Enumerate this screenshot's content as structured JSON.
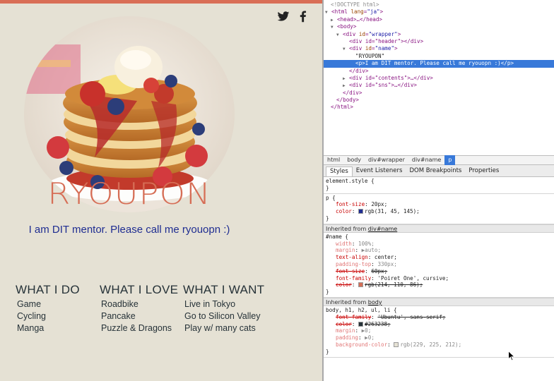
{
  "page": {
    "name_title": "RYOUPON",
    "mentor_text": "I am DIT mentor. Please call me ryouopn :)",
    "sns_icons": [
      "twitter-icon",
      "facebook-icon"
    ],
    "hero_image": "pancake-stack-photo",
    "columns": [
      {
        "heading": "WHAT I DO",
        "items": [
          "Game",
          "Cycling",
          "Manga"
        ]
      },
      {
        "heading": "WHAT I LOVE",
        "items": [
          "Roadbike",
          "Pancake",
          "Puzzle & Dragons"
        ]
      },
      {
        "heading": "WHAT I WANT",
        "items": [
          "Live in Tokyo",
          "Go to Silicon Valley",
          "Play w/ many cats"
        ]
      }
    ],
    "colors": {
      "background": "#e5e1d4",
      "accent": "#d66e56",
      "mentor_text": "#1f2d91",
      "text": "#263238"
    }
  },
  "devtools": {
    "dom": {
      "doctype": "<!DOCTYPE html>",
      "html_open_tag": "html",
      "html_lang_attr": "lang",
      "html_lang_val": "\"ja\"",
      "head": "<head>…</head>",
      "body_open": "<body>",
      "wrapper_tag": "<div ",
      "wrapper_attr": "id",
      "wrapper_val": "\"wrapper\"",
      "header_line": "<div id=\"header\"></div>",
      "name_tag": "<div ",
      "name_attr": "id",
      "name_val": "\"name\"",
      "name_text": "\"RYOUPON\"",
      "p_line": "<p>I am DIT mentor. Please call me ryouopn :)</p>",
      "div_close": "</div>",
      "contents_line": "<div id=\"contents\">…</div>",
      "sns_line": "<div id=\"sns\">…</div>",
      "div_close2": "</div>",
      "body_close": "</body>",
      "html_close": "</html>"
    },
    "breadcrumbs": [
      "html",
      "body",
      "div#wrapper",
      "div#name",
      "p"
    ],
    "tabs": [
      "Styles",
      "Event Listeners",
      "DOM Breakpoints",
      "Properties"
    ],
    "styles": {
      "element_style_open": "element.style {",
      "element_style_close": "}",
      "p_rule_selector": "p {",
      "p_font_size_name": "font-size",
      "p_font_size_val": "20px;",
      "p_color_name": "color",
      "p_color_val": "rgb(31, 45, 145);",
      "p_color_hex": "#1f2d91",
      "p_rule_close": "}",
      "inherited_prefix_1": "Inherited from ",
      "inherited_link_1": "div#name",
      "name_rule_selector": "#name {",
      "name_props": [
        {
          "name": "width",
          "value": "100%;",
          "dim": true,
          "strike": false
        },
        {
          "name": "margin",
          "value": "▶auto;",
          "dim": true,
          "strike": false
        },
        {
          "name": "text-align",
          "value": "center;",
          "dim": false,
          "strike": false
        },
        {
          "name": "padding-top",
          "value": "330px;",
          "dim": true,
          "strike": false
        },
        {
          "name": "font-size",
          "value": "60px;",
          "dim": false,
          "strike": true
        },
        {
          "name": "font-family",
          "value": "'Poiret One', cursive;",
          "dim": false,
          "strike": false
        }
      ],
      "name_color_name": "color",
      "name_color_val": "rgb(214, 110, 86);",
      "name_color_hex": "#d66e56",
      "name_rule_close": "}",
      "inherited_prefix_2": "Inherited from ",
      "inherited_link_2": "body",
      "body_rule_selector": "body, h1, h2, ul, li {",
      "body_font_family_name": "font-family",
      "body_font_family_val": "'Ubuntu', sans-serif;",
      "body_color_name": "color",
      "body_color_val": "#263238;",
      "body_color_hex": "#263238",
      "body_margin_name": "margin",
      "body_margin_val": "▶0;",
      "body_padding_name": "padding",
      "body_padding_val": "▶0;",
      "body_bg_name": "background-color",
      "body_bg_val": "rgb(229, 225, 212);",
      "body_bg_hex": "#e5e1d4",
      "body_rule_close": "}"
    }
  }
}
